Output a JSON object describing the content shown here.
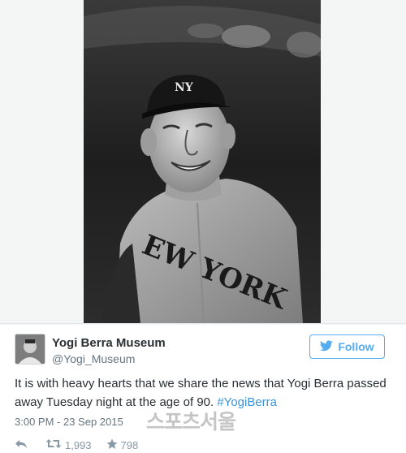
{
  "tweet": {
    "user": {
      "display_name": "Yogi Berra Museum",
      "handle": "@Yogi_Museum"
    },
    "follow_label": "Follow",
    "text_main": "It is with heavy hearts that we share the news that Yogi Berra passed away Tuesday night at the age of 90.",
    "hashtag": "#YogiBerra",
    "timestamp": "3:00 PM - 23 Sep 2015",
    "retweet_count": "1,993",
    "favorite_count": "798"
  },
  "watermark": "스포츠서울",
  "icons": {
    "follow": "twitter-bird-icon",
    "reply": "reply-icon",
    "retweet": "retweet-icon",
    "favorite": "star-icon"
  },
  "colors": {
    "accent": "#55acee",
    "hashtag": "#3b94d9",
    "meta_text": "#66757f",
    "action_icons": "#8899a6"
  }
}
